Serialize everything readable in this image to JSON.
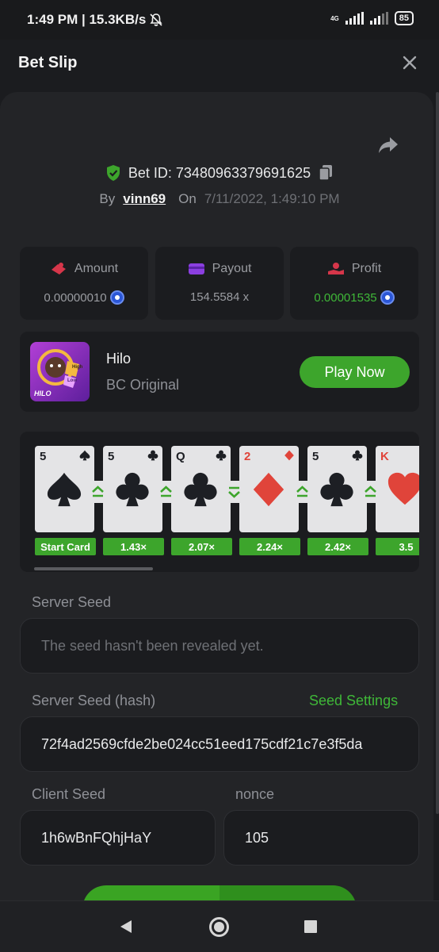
{
  "status_bar": {
    "time": "1:49 PM | 15.3KB/s",
    "network": "4G",
    "battery": "85"
  },
  "header": {
    "title": "Bet Slip"
  },
  "bet": {
    "bet_id": "Bet ID: 734809633796916​25",
    "by_label": "By",
    "username": "vinn69",
    "on_label": "On",
    "datetime": "7/11/2022, 1:49:10 PM"
  },
  "stats": {
    "amount_label": "Amount",
    "amount_value": "0.00000010",
    "payout_label": "Payout",
    "payout_value": "154.5584 x",
    "profit_label": "Profit",
    "profit_value": "0.00001535"
  },
  "game": {
    "name": "Hilo",
    "subtitle": "BC Original",
    "play_label": "Play Now",
    "thumb_text": "HILO",
    "thumb_high": "High",
    "thumb_low": "Low"
  },
  "cards": [
    {
      "rank": "5",
      "suit": "spade",
      "color": "#1d1f24",
      "multiplier": "Start Card"
    },
    {
      "rank": "5",
      "suit": "club",
      "color": "#1d1f24",
      "multiplier": "1.43×"
    },
    {
      "rank": "Q",
      "suit": "club",
      "color": "#1d1f24",
      "multiplier": "2.07×"
    },
    {
      "rank": "2",
      "suit": "diamond",
      "color": "#e0443a",
      "multiplier": "2.24×"
    },
    {
      "rank": "5",
      "suit": "club",
      "color": "#1d1f24",
      "multiplier": "2.42×"
    },
    {
      "rank": "K",
      "suit": "heart",
      "color": "#e0443a",
      "multiplier": "3.5"
    }
  ],
  "arrows": [
    "up",
    "up",
    "down",
    "up",
    "up"
  ],
  "server_seed": {
    "label": "Server Seed",
    "placeholder": "The seed hasn't been revealed yet."
  },
  "server_hash": {
    "label": "Server Seed (hash)",
    "settings_label": "Seed Settings",
    "value": "72f4ad2569cfde2be024cc51eed175cdf21c7e3f5da"
  },
  "client_seed": {
    "label": "Client Seed",
    "value": "1h6wBnFQhjHaY"
  },
  "nonce": {
    "label": "nonce",
    "value": "105"
  },
  "colors": {
    "accent": "#3da52c",
    "background": "#1b1c1f",
    "panel": "#232427"
  }
}
